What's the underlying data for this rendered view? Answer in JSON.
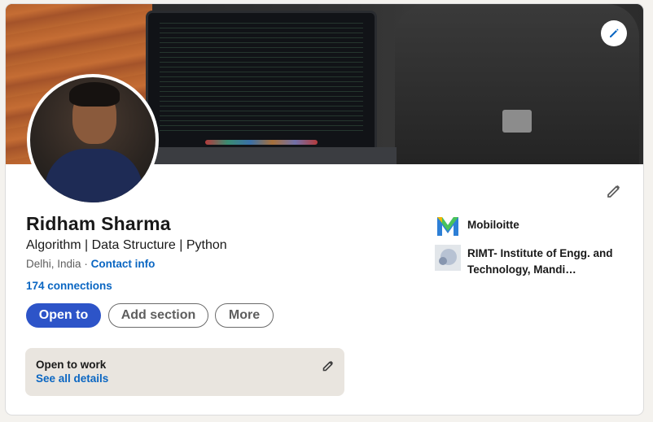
{
  "profile": {
    "name": "Ridham Sharma",
    "headline": "Algorithm | Data Structure | Python",
    "location": "Delhi, India",
    "separator": "·",
    "contact_info": "Contact info",
    "connections": "174 connections"
  },
  "actions": {
    "open_to": "Open to",
    "add_section": "Add section",
    "more": "More"
  },
  "open_to_work": {
    "title": "Open to work",
    "details_link": "See all details"
  },
  "experience": {
    "company": "Mobiloitte",
    "school": "RIMT- Institute of Engg. and Technology, Mandi…"
  },
  "icons": {
    "cover_edit": "pencil-icon",
    "intro_edit": "pencil-icon",
    "open_to_work_edit": "pencil-icon",
    "company_logo": "mobiloitte-logo",
    "school_logo": "school-logo"
  },
  "colors": {
    "primary": "#2d54c8",
    "link": "#0a66c2",
    "open_to_work_bg": "#e9e5df",
    "mobiloitte_green": "#4ac35a",
    "mobiloitte_blue": "#2d7fd6"
  }
}
